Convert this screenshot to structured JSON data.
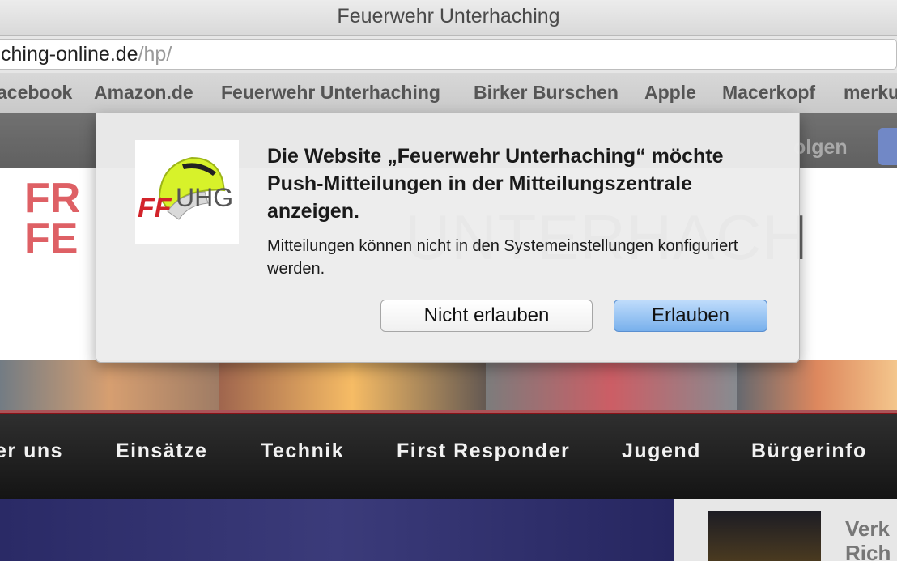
{
  "window": {
    "title": "Feuerwehr Unterhaching"
  },
  "address_bar": {
    "host": "ching-online.de",
    "path": "/hp/"
  },
  "bookmarks": [
    "acebook",
    "Amazon.de",
    "Feuerwehr Unterhaching",
    "Birker Burschen",
    "Apple",
    "Macerkopf",
    "merku"
  ],
  "website": {
    "header_link": "olgen",
    "nav": [
      "er uns",
      "Einsätze",
      "Technik",
      "First Responder",
      "Jugend",
      "Bürgerinfo"
    ],
    "sidebar_headline_1": "Verk",
    "sidebar_headline_2": "Rich"
  },
  "dialog": {
    "icon_name": "ffuhg-helmet-logo-icon",
    "title": "Die Website „Feuerwehr Unterhaching“ möchte Push-Mitteilungen in der Mitteilungszentrale anzeigen.",
    "message": "Mitteilungen können nicht in den Systemeinstellungen konfiguriert werden.",
    "deny_label": "Nicht erlauben",
    "allow_label": "Erlauben"
  },
  "colors": {
    "allow_button": "#78b0ec",
    "brand_red": "#d2232a",
    "facebook_blue": "#3b5bb0"
  }
}
